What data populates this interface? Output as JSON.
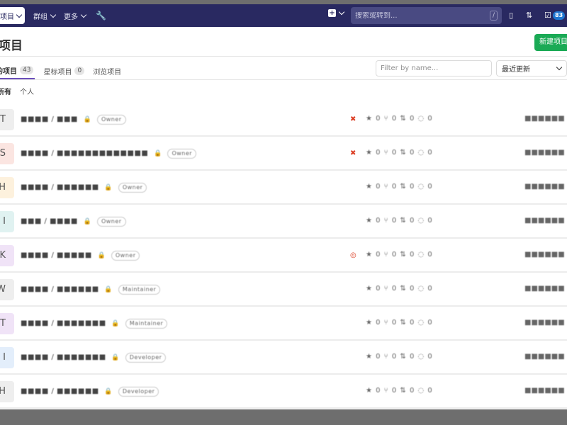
{
  "nav": {
    "projects_label": "项目",
    "groups_label": "群组",
    "more_label": "更多",
    "search_placeholder": "搜索或转到...",
    "search_shortcut": "/",
    "todo_count": "83"
  },
  "header": {
    "title": "项目",
    "new_project_label": "新建项目"
  },
  "tabs": [
    {
      "label": "我的项目",
      "count": "43"
    },
    {
      "label": "星标项目",
      "count": "0"
    },
    {
      "label": "浏览项目",
      "count": ""
    }
  ],
  "filter": {
    "placeholder": "Filter by name...",
    "sort_label": "最近更新"
  },
  "subtabs": [
    "所有",
    "个人"
  ],
  "projects": [
    {
      "initial": "T",
      "avatar_color": "#eeeeee",
      "name": "■■■■ / ■■■",
      "role": "Owner",
      "ci": "fail",
      "stats": "★ 0   ⑂ 0   ⇅ 0   ◌ 0",
      "updated": "■■■■■■"
    },
    {
      "initial": "S",
      "avatar_color": "#fbe5e1",
      "name": "■■■■ / ■■■■■■■■■■■■■",
      "role": "Owner",
      "ci": "fail",
      "stats": "★ 0   ⑂ 0   ⇅ 0   ◌ 0",
      "updated": "■■■■■■"
    },
    {
      "initial": "H",
      "avatar_color": "#fdf1dd",
      "name": "■■■■ / ■■■■■■",
      "role": "Owner",
      "ci": "",
      "stats": "★ 0   ⑂ 0   ⇅ 0   ◌ 0",
      "updated": "■■■■■■"
    },
    {
      "initial": "I",
      "avatar_color": "#e0f2f1",
      "name": "■■■ / ■■■■",
      "role": "Owner",
      "ci": "",
      "stats": "★ 0   ⑂ 0   ⇅ 0   ◌ 0",
      "updated": "■■■■■■"
    },
    {
      "initial": "K",
      "avatar_color": "#f0e3f7",
      "name": "■■■■ / ■■■■■",
      "role": "Owner",
      "ci": "running",
      "stats": "★ 0   ⑂ 0   ⇅ 0   ◌ 0",
      "updated": "■■■■■■"
    },
    {
      "initial": "W",
      "avatar_color": "#eeeeee",
      "name": "■■■■ / ■■■■■■",
      "role": "Maintainer",
      "ci": "",
      "stats": "★ 0   ⑂ 0   ⇅ 0   ◌ 0",
      "updated": "■■■■■■"
    },
    {
      "initial": "T",
      "avatar_color": "#f0e3f7",
      "name": "■■■■ / ■■■■■■■",
      "role": "Maintainer",
      "ci": "",
      "stats": "★ 0   ⑂ 0   ⇅ 0   ◌ 0",
      "updated": "■■■■■■"
    },
    {
      "initial": "I",
      "avatar_color": "#e3eefb",
      "name": "■■■■ / ■■■■■■■",
      "role": "Developer",
      "ci": "",
      "stats": "★ 0   ⑂ 0   ⇅ 0   ◌ 0",
      "updated": "■■■■■■"
    },
    {
      "initial": "H",
      "avatar_color": "#eeeeee",
      "name": "■■■■ / ■■■■■■",
      "role": "Developer",
      "ci": "",
      "stats": "★ 0   ⑂ 0   ⇅ 0   ◌ 0",
      "updated": "■■■■■■"
    }
  ],
  "colors": {
    "navbar": "#292961",
    "accent_tab": "#6b4fbb",
    "new_button": "#1aaa55",
    "ci_fail": "#db3b21",
    "ci_running": "#db3b21"
  }
}
